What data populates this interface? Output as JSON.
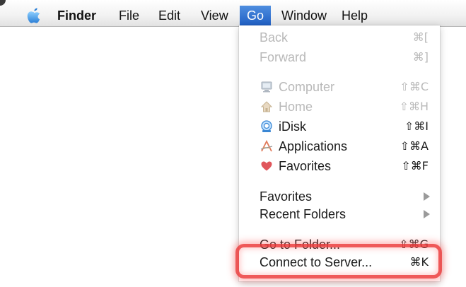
{
  "menubar": {
    "apple_icon": "apple-logo-icon",
    "items": [
      {
        "label": "Finder"
      },
      {
        "label": "File"
      },
      {
        "label": "Edit"
      },
      {
        "label": "View"
      },
      {
        "label": "Go"
      },
      {
        "label": "Window"
      },
      {
        "label": "Help"
      }
    ],
    "active_color": "#2a6ad0"
  },
  "go_menu": {
    "items": [
      {
        "label": "Back",
        "shortcut": "⌘[",
        "enabled": false
      },
      {
        "label": "Forward",
        "shortcut": "⌘]",
        "enabled": false
      },
      {
        "label": "Computer",
        "shortcut": "⇧⌘C",
        "enabled": false,
        "icon": "computer-icon"
      },
      {
        "label": "Home",
        "shortcut": "⇧⌘H",
        "enabled": false,
        "icon": "home-icon"
      },
      {
        "label": "iDisk",
        "shortcut": "⇧⌘I",
        "enabled": true,
        "icon": "idisk-icon"
      },
      {
        "label": "Applications",
        "shortcut": "⇧⌘A",
        "enabled": true,
        "icon": "applications-icon"
      },
      {
        "label": "Favorites",
        "shortcut": "⇧⌘F",
        "enabled": true,
        "icon": "favorites-heart-icon"
      },
      {
        "label": "Favorites",
        "submenu": true,
        "enabled": true
      },
      {
        "label": "Recent Folders",
        "submenu": true,
        "enabled": true
      },
      {
        "label": "Go to Folder...",
        "shortcut": "⇧⌘G",
        "enabled": true
      },
      {
        "label": "Connect to Server...",
        "shortcut": "⌘K",
        "enabled": true
      }
    ],
    "highlight_color": "#ec3c3c"
  }
}
